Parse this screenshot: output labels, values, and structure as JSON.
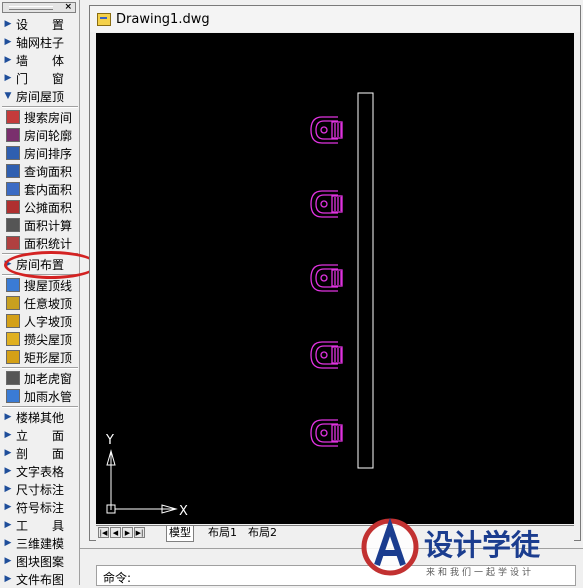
{
  "palette": {
    "items": [
      {
        "label": "设 置",
        "spread": true,
        "arrow": "▶"
      },
      {
        "label": "轴网柱子",
        "spread": false,
        "arrow": "▶"
      },
      {
        "label": "墙 体",
        "spread": true,
        "arrow": "▶"
      },
      {
        "label": "门 窗",
        "spread": true,
        "arrow": "▶"
      },
      {
        "label": "房间屋顶",
        "spread": false,
        "arrow": "▼"
      },
      {
        "label": "搜索房间",
        "spread": false,
        "icon": "#c43b3b"
      },
      {
        "label": "房间轮廓",
        "spread": false,
        "icon": "#7a2f6d"
      },
      {
        "label": "房间排序",
        "spread": false,
        "icon": "#2f5fb0"
      },
      {
        "label": "查询面积",
        "spread": false,
        "icon": "#2f5fb0"
      },
      {
        "label": "套内面积",
        "spread": false,
        "icon": "#3b6bc4"
      },
      {
        "label": "公摊面积",
        "spread": false,
        "icon": "#b03030"
      },
      {
        "label": "面积计算",
        "spread": false,
        "icon": "#555555"
      },
      {
        "label": "面积统计",
        "spread": false,
        "icon": "#b04040"
      },
      {
        "label": "房间布置",
        "spread": false,
        "arrow": "▶"
      },
      {
        "label": "搜屋顶线",
        "spread": false,
        "icon": "#3a7bd5"
      },
      {
        "label": "任意坡顶",
        "spread": false,
        "icon": "#c8a020"
      },
      {
        "label": "人字坡顶",
        "spread": false,
        "icon": "#d4a017"
      },
      {
        "label": "攒尖屋顶",
        "spread": false,
        "icon": "#e0b020"
      },
      {
        "label": "矩形屋顶",
        "spread": false,
        "icon": "#d4a017"
      },
      {
        "label": "加老虎窗",
        "spread": false,
        "icon": "#555555"
      },
      {
        "label": "加雨水管",
        "spread": false,
        "icon": "#3a7bd5"
      },
      {
        "label": "楼梯其他",
        "spread": false,
        "arrow": "▶"
      },
      {
        "label": "立 面",
        "spread": true,
        "arrow": "▶"
      },
      {
        "label": "剖 面",
        "spread": true,
        "arrow": "▶"
      },
      {
        "label": "文字表格",
        "spread": false,
        "arrow": "▶"
      },
      {
        "label": "尺寸标注",
        "spread": false,
        "arrow": "▶"
      },
      {
        "label": "符号标注",
        "spread": false,
        "arrow": "▶"
      },
      {
        "label": "工 具",
        "spread": true,
        "arrow": "▶"
      },
      {
        "label": "三维建模",
        "spread": false,
        "arrow": "▶"
      },
      {
        "label": "图块图案",
        "spread": false,
        "arrow": "▶"
      },
      {
        "label": "文件布图",
        "spread": false,
        "arrow": "▶"
      }
    ]
  },
  "document": {
    "title": "Drawing1.dwg"
  },
  "axes": {
    "y_label": "Y",
    "x_label": "X"
  },
  "tabs": [
    "模型",
    "布局1",
    "布局2"
  ],
  "command": {
    "prompt": "命令:"
  },
  "watermark": {
    "main": "设计学徒",
    "sub": "来和我们一起学设计"
  },
  "colors": {
    "entity": "#e033e0",
    "canvas": "#000000",
    "highlight": "#d32222"
  }
}
